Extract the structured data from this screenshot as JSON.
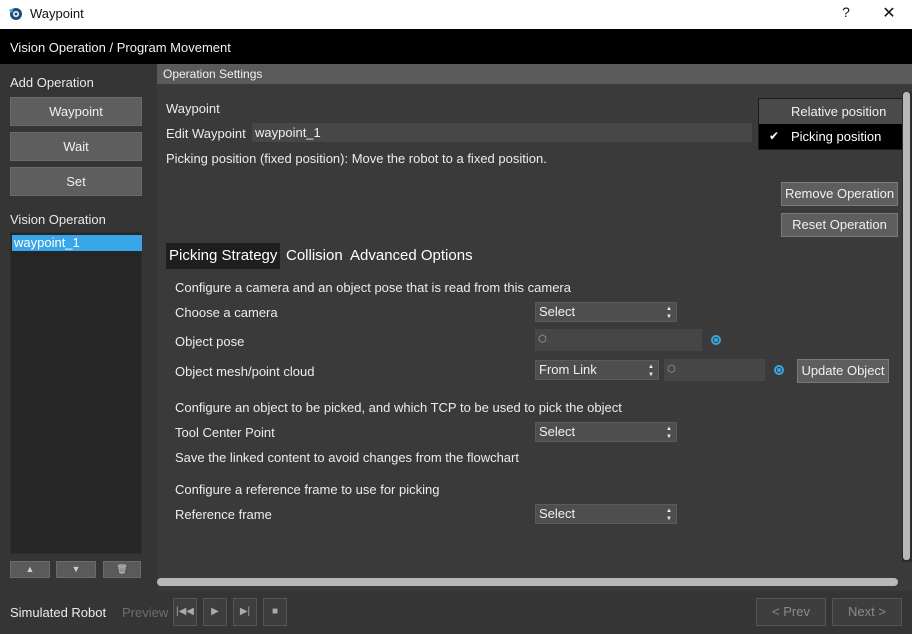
{
  "window": {
    "title": "Waypoint",
    "help_label": "?",
    "close_label": "✕"
  },
  "header": {
    "breadcrumb": "Vision Operation / Program Movement"
  },
  "left_panel": {
    "add_title": "Add Operation",
    "buttons": [
      "Waypoint",
      "Wait",
      "Set"
    ],
    "vision_title": "Vision Operation",
    "vision_items": [
      "waypoint_1"
    ],
    "move_up_label": "▲",
    "move_down_label": "▼",
    "delete_label": "🗑"
  },
  "settings": {
    "header": "Operation Settings",
    "type_label": "Waypoint",
    "edit_label": "Edit Waypoint",
    "edit_value": "waypoint_1",
    "description": "Picking position (fixed position): Move the robot to a fixed position.",
    "remove_label": "Remove Operation",
    "reset_label": "Reset Operation"
  },
  "menu": {
    "items": [
      "Relative position",
      "Picking position"
    ],
    "checked": "Picking position",
    "check_glyph": "✔"
  },
  "tabs": [
    "Picking Strategy",
    "Collision",
    "Advanced Options"
  ],
  "picking": {
    "camera_intro": "Configure a camera and an object pose that is read from this camera",
    "camera_label": "Choose a camera",
    "camera_value": "Select",
    "pose_label": "Object pose",
    "mesh_label": "Object mesh/point cloud",
    "mesh_value": "From Link",
    "update_label": "Update Object",
    "object_intro": "Configure an object to be picked, and which TCP to be used to pick the object",
    "tcp_label": "Tool Center Point",
    "tcp_value": "Select",
    "save_note": "Save the linked content to avoid changes from the flowchart",
    "ref_intro": "Configure a reference frame to use for picking",
    "ref_label": "Reference frame",
    "ref_value": "Select"
  },
  "footer": {
    "robot_label": "Simulated Robot",
    "preview_label": "Preview",
    "prev_label": "< Prev",
    "next_label": "Next >"
  }
}
